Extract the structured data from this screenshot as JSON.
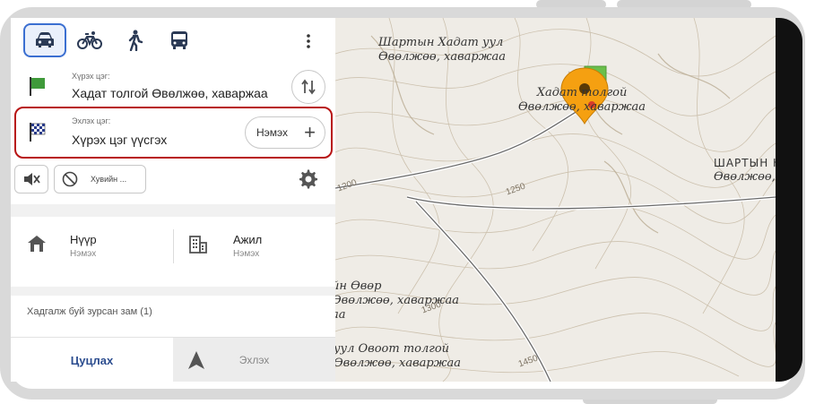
{
  "modes": [
    {
      "icon": "car-icon",
      "active": true
    },
    {
      "icon": "bicycle-icon",
      "active": false
    },
    {
      "icon": "walking-icon",
      "active": false
    },
    {
      "icon": "bus-icon",
      "active": false
    }
  ],
  "destination": {
    "label": "Хүрэх цэг:",
    "value": "Хадат толгой Өвөлжөө, хаваржаа",
    "icon": "flag-icon"
  },
  "start": {
    "label": "Эхлэх цэг:",
    "value": "Хүрэх цэг үүсгэх",
    "icon": "checkered-flag-icon"
  },
  "add_button": {
    "label": "Нэмэх",
    "plus": "+"
  },
  "options": {
    "mute_icon": "mute-icon",
    "custom_label": "Хувийн ...",
    "settings_icon": "gear-icon"
  },
  "home": {
    "title": "Нүүр",
    "subtitle": "Нэмэх"
  },
  "work": {
    "title": "Ажил",
    "subtitle": "Нэмэх"
  },
  "saved_routes": "Хадгалж буй зурсан зам (1)",
  "bottom": {
    "cancel": "Цуцлах",
    "start": "Эхлэх"
  },
  "map": {
    "labels": [
      {
        "line1": "Шартын Хадат уул",
        "line2": "Өвөлжөө, хаваржаа"
      },
      {
        "line1": "Хадат толгой",
        "line2": "Өвөлжөө, хаваржаа"
      },
      {
        "line1": "ШАРТЫН Н",
        "line2": "Өвөлжөө, хаваржаа"
      },
      {
        "line1": "йн Өвөр",
        "line2": "Өвөлжөө, хаваржаа",
        "line3": "аа"
      },
      {
        "line1": "уул Овоот толгой",
        "line2": "Өвөлжөө, хаваржаа"
      }
    ],
    "contours": [
      "1250",
      "1200",
      "1300",
      "1450"
    ],
    "pin_color": "#f5a011",
    "flag_color": "#6abf4b"
  }
}
